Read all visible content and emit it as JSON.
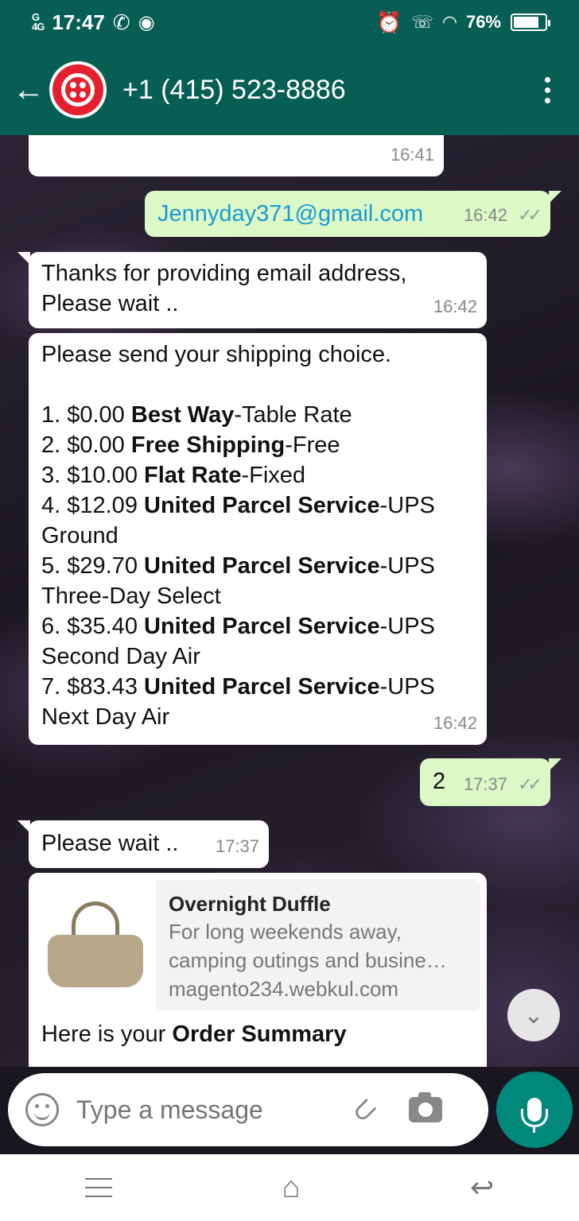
{
  "status": {
    "time": "17:47",
    "signal_label": "G\n4G",
    "battery": "76%",
    "battery_level": 0.76
  },
  "header": {
    "contact": "+1 (415) 523-8886",
    "back_icon": "arrow-left-icon",
    "avatar_icon": "twilio-logo"
  },
  "messages": [
    {
      "id": "m1",
      "dir": "in",
      "time": "16:41"
    },
    {
      "id": "m2",
      "dir": "out",
      "text": "Jennyday371@gmail.com",
      "time": "16:42",
      "ticks": "✓✓"
    },
    {
      "id": "m3",
      "dir": "in",
      "line1": "Thanks for providing email address,",
      "line2": "Please wait ..",
      "time": "16:42"
    },
    {
      "id": "m4",
      "dir": "in",
      "intro": "Please send your shipping choice.",
      "time": "16:42",
      "options": [
        {
          "n": "1. $0.00 ",
          "b": "Best Way",
          "r": "-Table Rate"
        },
        {
          "n": "2. $0.00 ",
          "b": "Free Shipping",
          "r": "-Free"
        },
        {
          "n": "3. $10.00 ",
          "b": "Flat Rate",
          "r": "-Fixed"
        },
        {
          "n": "4. $12.09 ",
          "b": "United Parcel Service",
          "r": "-UPS",
          "r2": "Ground"
        },
        {
          "n": "5. $29.70 ",
          "b": "United Parcel Service",
          "r": "-UPS",
          "r2": "Three-Day Select"
        },
        {
          "n": "6. $35.40 ",
          "b": "United Parcel Service",
          "r": "-UPS",
          "r2": "Second Day Air"
        },
        {
          "n": "7. $83.43 ",
          "b": "United Parcel Service",
          "r": "-UPS",
          "r2": "Next Day Air"
        }
      ]
    },
    {
      "id": "m5",
      "dir": "out",
      "text": "2",
      "time": "17:37",
      "ticks": "✓✓"
    },
    {
      "id": "m6",
      "dir": "in",
      "text": "Please wait ..",
      "time": "17:37"
    },
    {
      "id": "m7",
      "dir": "in",
      "preview": {
        "title": "Overnight Duffle",
        "desc1": "For long weekends away,",
        "desc2": "camping outings and busine…",
        "url": "magento234.webkul.com"
      },
      "text_prefix": "Here is your ",
      "text_bold": "Order Summary"
    }
  ],
  "input": {
    "placeholder": "Type a message"
  }
}
